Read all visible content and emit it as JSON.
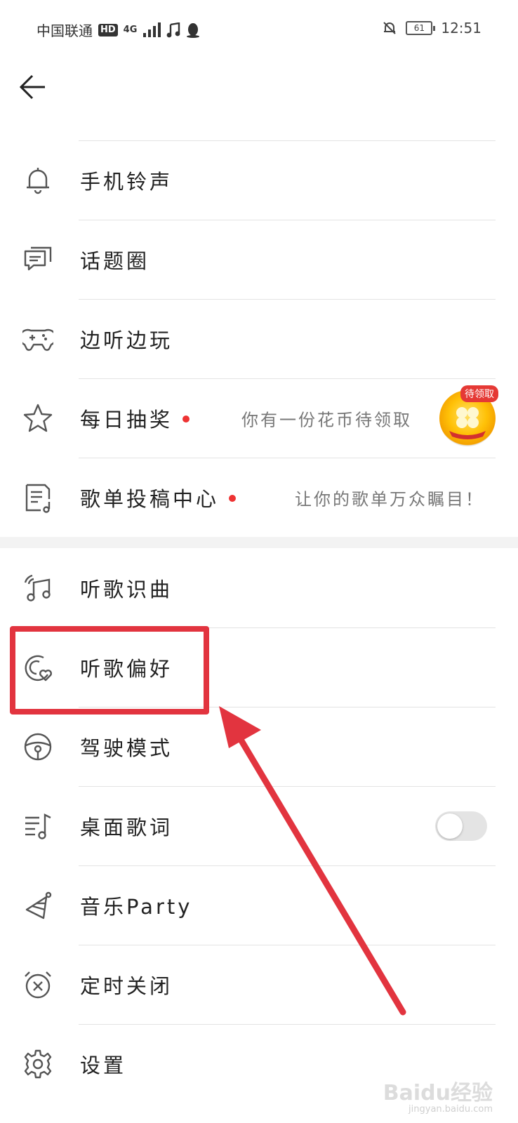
{
  "status_bar": {
    "carrier": "中国联通",
    "hd_badge": "HD",
    "network": "4G",
    "battery": "61",
    "time": "12:51"
  },
  "back_icon": "back-arrow-icon",
  "section1": [
    {
      "label": "手机铃声",
      "icon": "bell-icon"
    },
    {
      "label": "话题圈",
      "icon": "chat-icon"
    },
    {
      "label": "边听边玩",
      "icon": "gamepad-icon"
    },
    {
      "label": "每日抽奖",
      "icon": "star-icon",
      "hint": "你有一份花币待领取",
      "badge": "待领取"
    },
    {
      "label": "歌单投稿中心",
      "icon": "playlist-submit-icon",
      "hint": "让你的歌单万众瞩目！"
    }
  ],
  "section2": [
    {
      "label": "听歌识曲",
      "icon": "music-recognize-icon"
    },
    {
      "label": "听歌偏好",
      "icon": "preference-icon"
    },
    {
      "label": "驾驶模式",
      "icon": "steering-wheel-icon"
    },
    {
      "label": "桌面歌词",
      "icon": "lyrics-icon",
      "toggle_on": false
    },
    {
      "label": "音乐Party",
      "icon": "party-hat-icon"
    },
    {
      "label": "定时关闭",
      "icon": "alarm-clock-icon"
    },
    {
      "label": "设置",
      "icon": "gear-icon"
    }
  ],
  "watermark": {
    "brand": "Baidu经验",
    "url": "jingyan.baidu.com"
  },
  "colors": {
    "annotation_red": "#e2343f",
    "dot_red": "#e33333"
  }
}
